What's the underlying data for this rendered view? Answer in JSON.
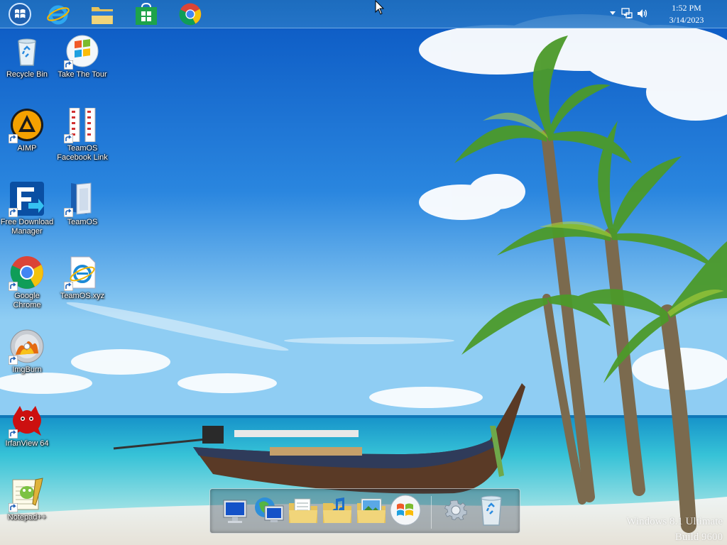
{
  "taskbar": {
    "start_button": "start-orb",
    "pinned": [
      {
        "name": "internet-explorer",
        "icon": "ie-icon"
      },
      {
        "name": "file-explorer",
        "icon": "folder-icon"
      },
      {
        "name": "store",
        "icon": "store-icon"
      },
      {
        "name": "chrome",
        "icon": "chrome-icon"
      }
    ],
    "tray": {
      "time": "1:52 PM",
      "date": "3/14/2023"
    }
  },
  "desktop_icons": [
    {
      "label": "Recycle Bin"
    },
    {
      "label": "Take The Tour"
    },
    {
      "label": "AIMP"
    },
    {
      "label": "TeamOS Facebook Link"
    },
    {
      "label": "Free Download Manager"
    },
    {
      "label": "TeamOS"
    },
    {
      "label": "Google Chrome"
    },
    {
      "label": "TeamOS.xyz"
    },
    {
      "label": "ImgBurn"
    },
    {
      "label": "IrfanView 64"
    },
    {
      "label": "Notepad++"
    }
  ],
  "dock": {
    "items": [
      "computer-icon",
      "network-icon",
      "documents-folder-icon",
      "music-folder-icon",
      "pictures-folder-icon",
      "windows-logo-icon",
      "settings-gear-icon",
      "recycle-bin-icon"
    ]
  },
  "watermark": {
    "line1": "Windows 8.1 Ultimate",
    "line2": "Build 9600"
  },
  "colors": {
    "taskbar": "#1e6ebe",
    "sky_top": "#0a5cc4",
    "sea": "#2ab6d0"
  }
}
